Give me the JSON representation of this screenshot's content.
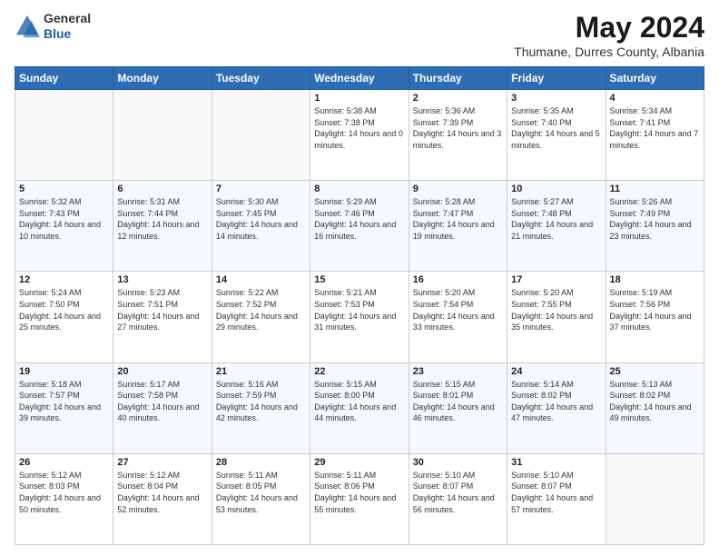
{
  "header": {
    "logo_line1": "General",
    "logo_line2": "Blue",
    "month_title": "May 2024",
    "location": "Thumane, Durres County, Albania"
  },
  "weekdays": [
    "Sunday",
    "Monday",
    "Tuesday",
    "Wednesday",
    "Thursday",
    "Friday",
    "Saturday"
  ],
  "weeks": [
    [
      {
        "day": "",
        "sunrise": "",
        "sunset": "",
        "daylight": ""
      },
      {
        "day": "",
        "sunrise": "",
        "sunset": "",
        "daylight": ""
      },
      {
        "day": "",
        "sunrise": "",
        "sunset": "",
        "daylight": ""
      },
      {
        "day": "1",
        "sunrise": "Sunrise: 5:38 AM",
        "sunset": "Sunset: 7:38 PM",
        "daylight": "Daylight: 14 hours and 0 minutes."
      },
      {
        "day": "2",
        "sunrise": "Sunrise: 5:36 AM",
        "sunset": "Sunset: 7:39 PM",
        "daylight": "Daylight: 14 hours and 3 minutes."
      },
      {
        "day": "3",
        "sunrise": "Sunrise: 5:35 AM",
        "sunset": "Sunset: 7:40 PM",
        "daylight": "Daylight: 14 hours and 5 minutes."
      },
      {
        "day": "4",
        "sunrise": "Sunrise: 5:34 AM",
        "sunset": "Sunset: 7:41 PM",
        "daylight": "Daylight: 14 hours and 7 minutes."
      }
    ],
    [
      {
        "day": "5",
        "sunrise": "Sunrise: 5:32 AM",
        "sunset": "Sunset: 7:43 PM",
        "daylight": "Daylight: 14 hours and 10 minutes."
      },
      {
        "day": "6",
        "sunrise": "Sunrise: 5:31 AM",
        "sunset": "Sunset: 7:44 PM",
        "daylight": "Daylight: 14 hours and 12 minutes."
      },
      {
        "day": "7",
        "sunrise": "Sunrise: 5:30 AM",
        "sunset": "Sunset: 7:45 PM",
        "daylight": "Daylight: 14 hours and 14 minutes."
      },
      {
        "day": "8",
        "sunrise": "Sunrise: 5:29 AM",
        "sunset": "Sunset: 7:46 PM",
        "daylight": "Daylight: 14 hours and 16 minutes."
      },
      {
        "day": "9",
        "sunrise": "Sunrise: 5:28 AM",
        "sunset": "Sunset: 7:47 PM",
        "daylight": "Daylight: 14 hours and 19 minutes."
      },
      {
        "day": "10",
        "sunrise": "Sunrise: 5:27 AM",
        "sunset": "Sunset: 7:48 PM",
        "daylight": "Daylight: 14 hours and 21 minutes."
      },
      {
        "day": "11",
        "sunrise": "Sunrise: 5:26 AM",
        "sunset": "Sunset: 7:49 PM",
        "daylight": "Daylight: 14 hours and 23 minutes."
      }
    ],
    [
      {
        "day": "12",
        "sunrise": "Sunrise: 5:24 AM",
        "sunset": "Sunset: 7:50 PM",
        "daylight": "Daylight: 14 hours and 25 minutes."
      },
      {
        "day": "13",
        "sunrise": "Sunrise: 5:23 AM",
        "sunset": "Sunset: 7:51 PM",
        "daylight": "Daylight: 14 hours and 27 minutes."
      },
      {
        "day": "14",
        "sunrise": "Sunrise: 5:22 AM",
        "sunset": "Sunset: 7:52 PM",
        "daylight": "Daylight: 14 hours and 29 minutes."
      },
      {
        "day": "15",
        "sunrise": "Sunrise: 5:21 AM",
        "sunset": "Sunset: 7:53 PM",
        "daylight": "Daylight: 14 hours and 31 minutes."
      },
      {
        "day": "16",
        "sunrise": "Sunrise: 5:20 AM",
        "sunset": "Sunset: 7:54 PM",
        "daylight": "Daylight: 14 hours and 33 minutes."
      },
      {
        "day": "17",
        "sunrise": "Sunrise: 5:20 AM",
        "sunset": "Sunset: 7:55 PM",
        "daylight": "Daylight: 14 hours and 35 minutes."
      },
      {
        "day": "18",
        "sunrise": "Sunrise: 5:19 AM",
        "sunset": "Sunset: 7:56 PM",
        "daylight": "Daylight: 14 hours and 37 minutes."
      }
    ],
    [
      {
        "day": "19",
        "sunrise": "Sunrise: 5:18 AM",
        "sunset": "Sunset: 7:57 PM",
        "daylight": "Daylight: 14 hours and 39 minutes."
      },
      {
        "day": "20",
        "sunrise": "Sunrise: 5:17 AM",
        "sunset": "Sunset: 7:58 PM",
        "daylight": "Daylight: 14 hours and 40 minutes."
      },
      {
        "day": "21",
        "sunrise": "Sunrise: 5:16 AM",
        "sunset": "Sunset: 7:59 PM",
        "daylight": "Daylight: 14 hours and 42 minutes."
      },
      {
        "day": "22",
        "sunrise": "Sunrise: 5:15 AM",
        "sunset": "Sunset: 8:00 PM",
        "daylight": "Daylight: 14 hours and 44 minutes."
      },
      {
        "day": "23",
        "sunrise": "Sunrise: 5:15 AM",
        "sunset": "Sunset: 8:01 PM",
        "daylight": "Daylight: 14 hours and 46 minutes."
      },
      {
        "day": "24",
        "sunrise": "Sunrise: 5:14 AM",
        "sunset": "Sunset: 8:02 PM",
        "daylight": "Daylight: 14 hours and 47 minutes."
      },
      {
        "day": "25",
        "sunrise": "Sunrise: 5:13 AM",
        "sunset": "Sunset: 8:02 PM",
        "daylight": "Daylight: 14 hours and 49 minutes."
      }
    ],
    [
      {
        "day": "26",
        "sunrise": "Sunrise: 5:12 AM",
        "sunset": "Sunset: 8:03 PM",
        "daylight": "Daylight: 14 hours and 50 minutes."
      },
      {
        "day": "27",
        "sunrise": "Sunrise: 5:12 AM",
        "sunset": "Sunset: 8:04 PM",
        "daylight": "Daylight: 14 hours and 52 minutes."
      },
      {
        "day": "28",
        "sunrise": "Sunrise: 5:11 AM",
        "sunset": "Sunset: 8:05 PM",
        "daylight": "Daylight: 14 hours and 53 minutes."
      },
      {
        "day": "29",
        "sunrise": "Sunrise: 5:11 AM",
        "sunset": "Sunset: 8:06 PM",
        "daylight": "Daylight: 14 hours and 55 minutes."
      },
      {
        "day": "30",
        "sunrise": "Sunrise: 5:10 AM",
        "sunset": "Sunset: 8:07 PM",
        "daylight": "Daylight: 14 hours and 56 minutes."
      },
      {
        "day": "31",
        "sunrise": "Sunrise: 5:10 AM",
        "sunset": "Sunset: 8:07 PM",
        "daylight": "Daylight: 14 hours and 57 minutes."
      },
      {
        "day": "",
        "sunrise": "",
        "sunset": "",
        "daylight": ""
      }
    ]
  ]
}
